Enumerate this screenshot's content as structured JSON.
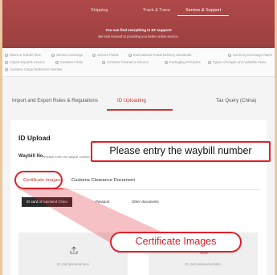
{
  "nav": {
    "items": [
      "Shipping",
      "Track & Trace",
      "Service & Support"
    ]
  },
  "hero": {
    "line1": "You can find everything in EF support!",
    "line2": "We look forward to providing you better online service."
  },
  "links": {
    "row1": [
      "Rates & Transit Time",
      "Service Coverage",
      "Service Points",
      "International Postal Delivery Standards",
      "Currency Exchange Rates"
    ],
    "row2": [
      "Airport Express Service",
      "Customer Rate",
      "Customs Clearance Service",
      "Packaging Principles",
      "Types of Fragile and Valuable Items"
    ],
    "row3": [
      "Customs Cargo Reference Number"
    ]
  },
  "tabs": {
    "import_export": "Import and Export Rules & Regulations",
    "id_uploading": "ID Uploading",
    "tax_query": "Tax Query (China)"
  },
  "panel": {
    "title": "ID Upload",
    "waybill_label": "Waybill No.",
    "waybill_placeholder": "Please enter the waybill number",
    "subtabs": [
      "Certificate Images",
      "Customs Clearance Document"
    ],
    "chips": [
      "ID card of mainland China",
      "Passport",
      "Other documents"
    ],
    "uploads": [
      "ID card personal face",
      "ID card national emblem"
    ]
  },
  "callouts": {
    "waybill": "Please entry the waybill number",
    "certificate": "Certificate Images"
  },
  "colors": {
    "brand_red": "#d43030",
    "callout_red": "#e0202a",
    "hero": "#a84545"
  }
}
